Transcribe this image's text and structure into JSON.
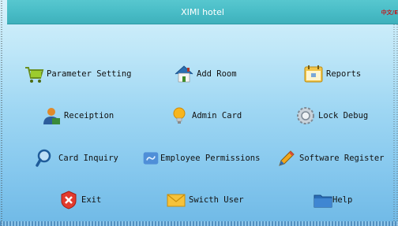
{
  "window": {
    "title": "XIMI hotel",
    "language_toggle": "中文/E"
  },
  "menu": {
    "parameter_setting": "Parameter Setting",
    "add_room": "Add Room",
    "reports": "Reports",
    "receiption": "Receiption",
    "admin_card": "Admin Card",
    "lock_debug": "Lock Debug",
    "card_inquiry": "Card Inquiry",
    "employee_permissions": "Employee Permissions",
    "software_register": "Software Register",
    "exit": "Exit",
    "switch_user": "Swicth User",
    "help": "Help"
  },
  "colors": {
    "title_bar": "#48bcc6",
    "background_top": "#d6f1fb",
    "background_bottom": "#6fb9e6",
    "language_text": "#c0191f"
  }
}
